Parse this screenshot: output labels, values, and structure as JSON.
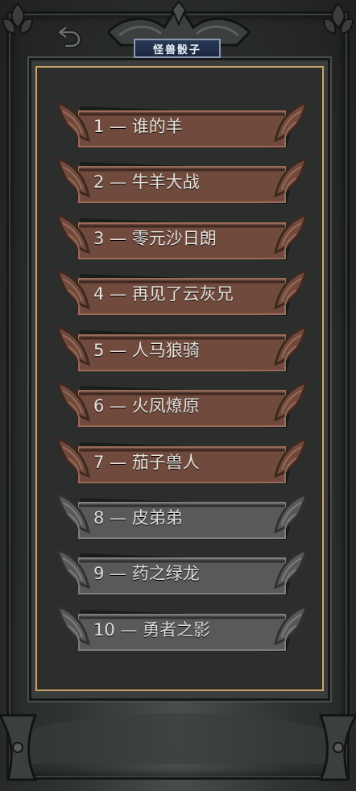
{
  "header": {
    "title": "怪兽骰子",
    "back_icon": "undo-arrow-icon"
  },
  "colors": {
    "unlocked_fill": "#6f4a3d",
    "unlocked_border": "#9a6a57",
    "locked_fill": "#575a59",
    "locked_border": "#7a7d7c",
    "panel_border": "#caa46a"
  },
  "levels": [
    {
      "label": "1 — 谁的羊",
      "state": "unlocked"
    },
    {
      "label": "2 — 牛羊大战",
      "state": "unlocked"
    },
    {
      "label": "3 — 零元沙日朗",
      "state": "unlocked"
    },
    {
      "label": "4 — 再见了云灰兄",
      "state": "unlocked"
    },
    {
      "label": "5 — 人马狼骑",
      "state": "unlocked"
    },
    {
      "label": "6 — 火凤燎原",
      "state": "unlocked"
    },
    {
      "label": "7 — 茄子兽人",
      "state": "unlocked"
    },
    {
      "label": "8 — 皮弟弟",
      "state": "locked"
    },
    {
      "label": "9 — 药之绿龙",
      "state": "locked"
    },
    {
      "label": "10 — 勇者之影",
      "state": "locked"
    }
  ]
}
